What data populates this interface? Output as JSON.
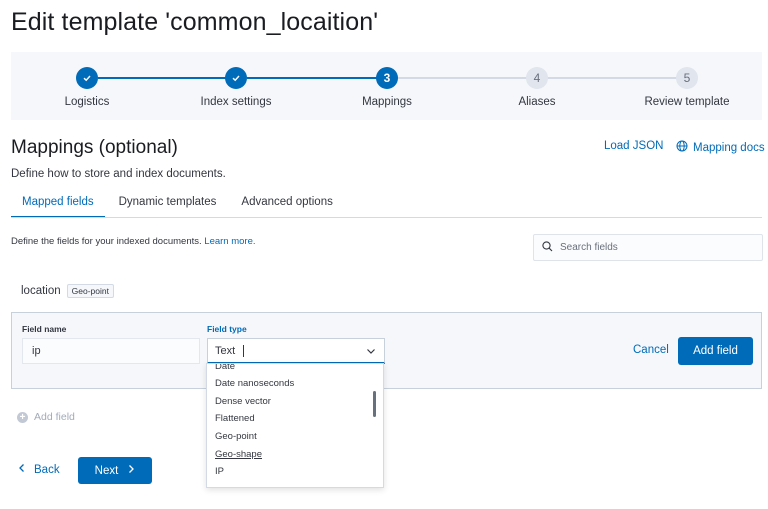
{
  "page": {
    "title": "Edit template 'common_locaition'"
  },
  "steps": [
    {
      "number": "1",
      "label": "Logistics",
      "state": "done"
    },
    {
      "number": "2",
      "label": "Index settings",
      "state": "done"
    },
    {
      "number": "3",
      "label": "Mappings",
      "state": "current"
    },
    {
      "number": "4",
      "label": "Aliases",
      "state": "todo"
    },
    {
      "number": "5",
      "label": "Review template",
      "state": "todo"
    }
  ],
  "section": {
    "title": "Mappings (optional)",
    "description": "Define how to store and index documents.",
    "load_json": "Load JSON",
    "mapping_docs": "Mapping docs"
  },
  "tabs": [
    {
      "label": "Mapped fields",
      "active": true
    },
    {
      "label": "Dynamic templates",
      "active": false
    },
    {
      "label": "Advanced options",
      "active": false
    }
  ],
  "fields": {
    "description": "Define the fields for your indexed documents.",
    "learn_more": "Learn more.",
    "search_placeholder": "Search fields"
  },
  "existing_field": {
    "name": "location",
    "type": "Geo-point"
  },
  "new_field": {
    "name_label": "Field name",
    "name_value": "ip",
    "type_label": "Field type",
    "type_value": "Text",
    "cancel": "Cancel",
    "add": "Add field"
  },
  "dropdown": {
    "options": [
      "Date",
      "Date nanoseconds",
      "Dense vector",
      "Flattened",
      "Geo-point",
      "Geo-shape",
      "IP"
    ]
  },
  "add_field_link": "Add field",
  "nav": {
    "back": "Back",
    "next": "Next"
  },
  "colors": {
    "primary": "#006bb8",
    "pending_step": "#e0e5ee",
    "panel_bg": "#f5f7fa"
  }
}
